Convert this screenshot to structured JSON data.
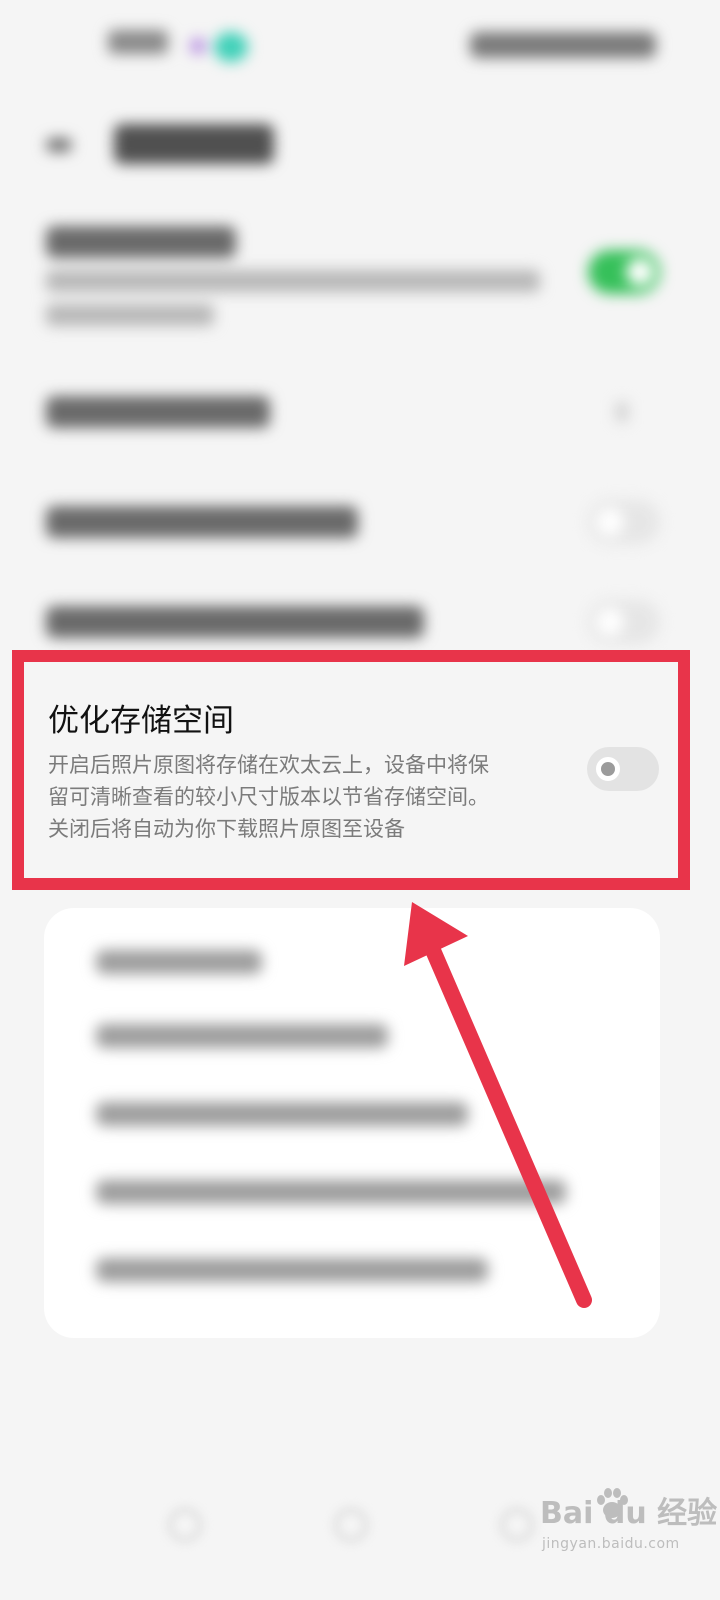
{
  "optimize_storage": {
    "title": "优化存储空间",
    "description_lines": [
      "开启后照片原图将存储在欢太云上，设备中将保",
      "留可清晰查看的较小尺寸版本以节省存储空间。",
      "关闭后将自动为你下载照片原图至设备"
    ],
    "toggle_on": false
  },
  "watermark": {
    "logo": "Bai du 经验",
    "url": "jingyan.baidu.com"
  },
  "colors": {
    "highlight": "#e8344a",
    "toggle_on": "#36c05a",
    "toggle_off": "#e3e3e3",
    "background": "#f5f5f5"
  },
  "icons": [
    "back-arrow-icon",
    "chevron-right-icon",
    "nav-back-icon",
    "nav-home-icon",
    "nav-recent-icon",
    "baidu-paw-icon"
  ]
}
